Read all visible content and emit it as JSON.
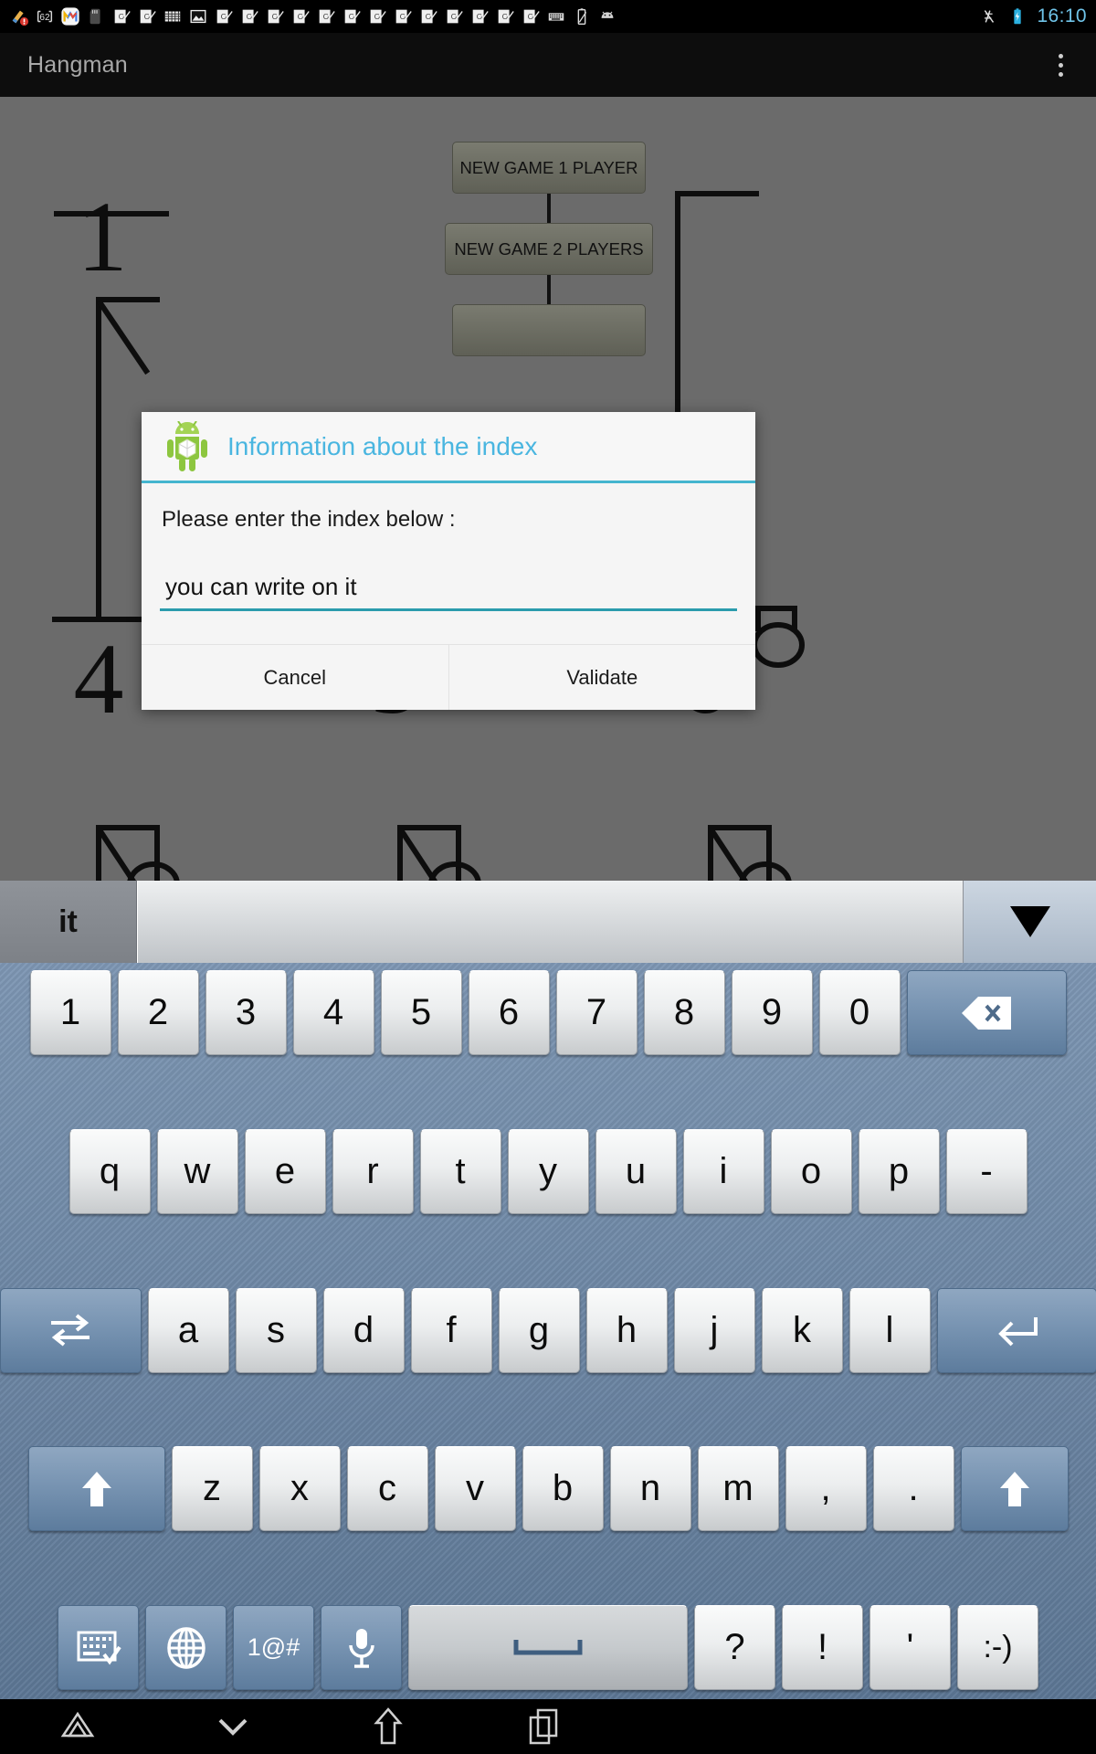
{
  "status_bar": {
    "clock": "16:10",
    "left_icons": [
      "cleaner-icon",
      "counter-62-icon",
      "gmail-icon",
      "sd-card-icon",
      "outlook-mail-icon",
      "outlook-mail-icon",
      "calendar-grid-icon",
      "photo-icon",
      "outlook-mail-icon",
      "outlook-mail-icon",
      "outlook-mail-icon",
      "outlook-mail-icon",
      "outlook-mail-icon",
      "outlook-mail-icon",
      "outlook-mail-icon",
      "outlook-mail-icon",
      "outlook-mail-icon",
      "outlook-mail-icon",
      "outlook-mail-icon",
      "outlook-mail-icon",
      "keyboard-icon",
      "battery-stats-icon",
      "android-head-icon"
    ],
    "right_icons": [
      "mute-icon",
      "battery-charging-icon"
    ]
  },
  "action_bar": {
    "title": "Hangman",
    "overflow_menu": "overflow-menu"
  },
  "game": {
    "menu_buttons": [
      {
        "label": "NEW GAME 1 PLAYER"
      },
      {
        "label": "NEW GAME 2 PLAYERS"
      }
    ],
    "stage_labels": [
      "1",
      "4",
      "5",
      "6"
    ],
    "background_color": "#6b6b6b"
  },
  "dialog": {
    "icon": "android-mascot-icon",
    "title": "Information about the index",
    "message": "Please enter the index below :",
    "input_value": "you can write on it",
    "input_placeholder": "",
    "accent_color": "#44b5cf",
    "buttons": {
      "cancel": "Cancel",
      "validate": "Validate"
    }
  },
  "keyboard": {
    "suggestion_word": "it",
    "expand_icon": "caret-down-icon",
    "rows": [
      {
        "keys": [
          {
            "label": "1",
            "name": "key-1",
            "type": "char"
          },
          {
            "label": "2",
            "name": "key-2",
            "type": "char"
          },
          {
            "label": "3",
            "name": "key-3",
            "type": "char"
          },
          {
            "label": "4",
            "name": "key-4",
            "type": "char"
          },
          {
            "label": "5",
            "name": "key-5",
            "type": "char"
          },
          {
            "label": "6",
            "name": "key-6",
            "type": "char"
          },
          {
            "label": "7",
            "name": "key-7",
            "type": "char"
          },
          {
            "label": "8",
            "name": "key-8",
            "type": "char"
          },
          {
            "label": "9",
            "name": "key-9",
            "type": "char"
          },
          {
            "label": "0",
            "name": "key-0",
            "type": "char"
          },
          {
            "label": "",
            "name": "backspace-key",
            "type": "icon",
            "icon": "backspace-icon"
          }
        ]
      },
      {
        "keys": [
          {
            "label": "q",
            "name": "key-q",
            "type": "char"
          },
          {
            "label": "w",
            "name": "key-w",
            "type": "char"
          },
          {
            "label": "e",
            "name": "key-e",
            "type": "char"
          },
          {
            "label": "r",
            "name": "key-r",
            "type": "char"
          },
          {
            "label": "t",
            "name": "key-t",
            "type": "char"
          },
          {
            "label": "y",
            "name": "key-y",
            "type": "char"
          },
          {
            "label": "u",
            "name": "key-u",
            "type": "char"
          },
          {
            "label": "i",
            "name": "key-i",
            "type": "char"
          },
          {
            "label": "o",
            "name": "key-o",
            "type": "char"
          },
          {
            "label": "p",
            "name": "key-p",
            "type": "char"
          },
          {
            "label": "-",
            "name": "key-hyphen",
            "type": "char"
          }
        ]
      },
      {
        "keys": [
          {
            "label": "",
            "name": "tab-key",
            "type": "icon",
            "icon": "tab-icon"
          },
          {
            "label": "a",
            "name": "key-a",
            "type": "char"
          },
          {
            "label": "s",
            "name": "key-s",
            "type": "char"
          },
          {
            "label": "d",
            "name": "key-d",
            "type": "char"
          },
          {
            "label": "f",
            "name": "key-f",
            "type": "char"
          },
          {
            "label": "g",
            "name": "key-g",
            "type": "char"
          },
          {
            "label": "h",
            "name": "key-h",
            "type": "char"
          },
          {
            "label": "j",
            "name": "key-j",
            "type": "char"
          },
          {
            "label": "k",
            "name": "key-k",
            "type": "char"
          },
          {
            "label": "l",
            "name": "key-l",
            "type": "char"
          },
          {
            "label": "",
            "name": "enter-key",
            "type": "icon",
            "icon": "enter-icon"
          }
        ]
      },
      {
        "keys": [
          {
            "label": "",
            "name": "shift-left-key",
            "type": "icon",
            "icon": "shift-up-arrow-icon"
          },
          {
            "label": "z",
            "name": "key-z",
            "type": "char"
          },
          {
            "label": "x",
            "name": "key-x",
            "type": "char"
          },
          {
            "label": "c",
            "name": "key-c",
            "type": "char"
          },
          {
            "label": "v",
            "name": "key-v",
            "type": "char"
          },
          {
            "label": "b",
            "name": "key-b",
            "type": "char"
          },
          {
            "label": "n",
            "name": "key-n",
            "type": "char"
          },
          {
            "label": "m",
            "name": "key-m",
            "type": "char"
          },
          {
            "label": ",",
            "name": "key-comma",
            "type": "char"
          },
          {
            "label": ".",
            "name": "key-period",
            "type": "char"
          },
          {
            "label": "",
            "name": "shift-right-key",
            "type": "icon",
            "icon": "shift-up-arrow-icon"
          }
        ]
      },
      {
        "keys": [
          {
            "label": "",
            "name": "keyboard-settings-key",
            "type": "icon",
            "icon": "keyboard-check-icon"
          },
          {
            "label": "",
            "name": "language-key",
            "type": "icon",
            "icon": "globe-icon"
          },
          {
            "label": "1@#",
            "name": "symbols-key",
            "type": "char"
          },
          {
            "label": "",
            "name": "voice-input-key",
            "type": "icon",
            "icon": "microphone-icon"
          },
          {
            "label": "",
            "name": "space-key",
            "type": "icon",
            "icon": "space-bar-icon"
          },
          {
            "label": "?",
            "name": "key-question",
            "type": "char"
          },
          {
            "label": "!",
            "name": "key-exclamation",
            "type": "char"
          },
          {
            "label": "'",
            "name": "key-apostrophe",
            "type": "char"
          },
          {
            "label": ":-)",
            "name": "key-emoticon",
            "type": "char"
          }
        ]
      }
    ]
  },
  "nav_bar": {
    "buttons": [
      {
        "name": "back-chevron-up-icon",
        "label": "back"
      },
      {
        "name": "hide-keyboard-icon",
        "label": "hide-keyboard"
      },
      {
        "name": "home-icon",
        "label": "home"
      },
      {
        "name": "recents-icon",
        "label": "recents"
      }
    ]
  }
}
